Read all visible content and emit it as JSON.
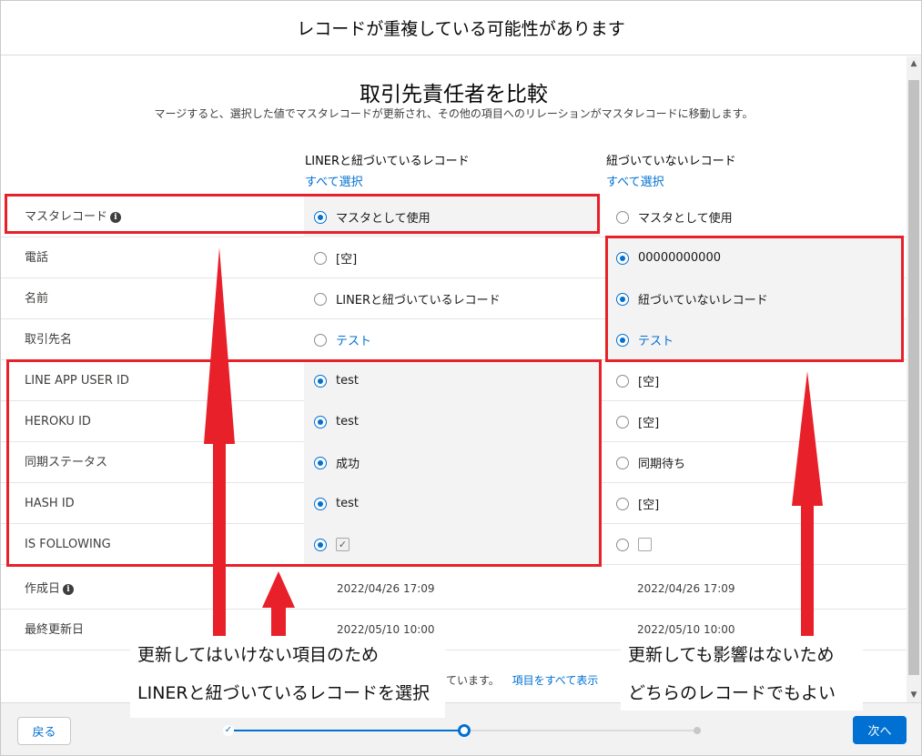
{
  "dialog": {
    "title": "レコードが重複している可能性があります",
    "compare_title": "取引先責任者を比較",
    "compare_subtitle": "マージすると、選択した値でマスタレコードが更新され、その他の項目へのリレーションがマスタレコードに移動します。"
  },
  "columns": {
    "left": {
      "heading": "LINERと紐づいているレコード",
      "select_all": "すべて選択"
    },
    "right": {
      "heading": "紐づいていないレコード",
      "select_all": "すべて選択"
    }
  },
  "master_row": {
    "label": "マスタレコード",
    "left_value": "マスタとして使用",
    "right_value": "マスタとして使用",
    "selected": "left"
  },
  "rows": [
    {
      "label": "電話",
      "left": "[空]",
      "right": "00000000000",
      "selected": "right"
    },
    {
      "label": "名前",
      "left": "LINERと紐づいているレコード",
      "right": "紐づいていないレコード",
      "selected": "right"
    },
    {
      "label": "取引先名",
      "left": "テスト",
      "right": "テスト",
      "selected": "right",
      "link": true
    },
    {
      "label": "LINE APP USER ID",
      "left": "test",
      "right": "[空]",
      "selected": "left"
    },
    {
      "label": "HEROKU ID",
      "left": "test",
      "right": "[空]",
      "selected": "left"
    },
    {
      "label": "同期ステータス",
      "left": "成功",
      "right": "同期待ち",
      "selected": "left"
    },
    {
      "label": "HASH ID",
      "left": "test",
      "right": "[空]",
      "selected": "left"
    },
    {
      "label": "IS FOLLOWING",
      "left": true,
      "right": false,
      "selected": "left",
      "checkbox": true
    }
  ],
  "readonly_rows": [
    {
      "label": "作成日",
      "left": "2022/04/26 17:09",
      "right": "2022/04/26 17:09",
      "info": true
    },
    {
      "label": "最終更新日",
      "left": "2022/05/10 10:00",
      "right": "2022/05/10 10:00"
    }
  ],
  "footer_text": {
    "partial": "ています。",
    "show_all": "項目をすべて表示"
  },
  "footer": {
    "back_label": "戻る",
    "next_label": "次へ",
    "current_step": 2,
    "total_steps": 3
  },
  "annotations": {
    "left_note_line1": "更新してはいけない項目のため",
    "left_note_line2": "LINERと紐づいているレコードを選択",
    "right_note_line1": "更新しても影響はないため",
    "right_note_line2": "どちらのレコードでもよい"
  },
  "colors": {
    "accent": "#0070d2",
    "annotation_red": "#e8202a",
    "selected_cell_bg": "#f3f3f3"
  }
}
